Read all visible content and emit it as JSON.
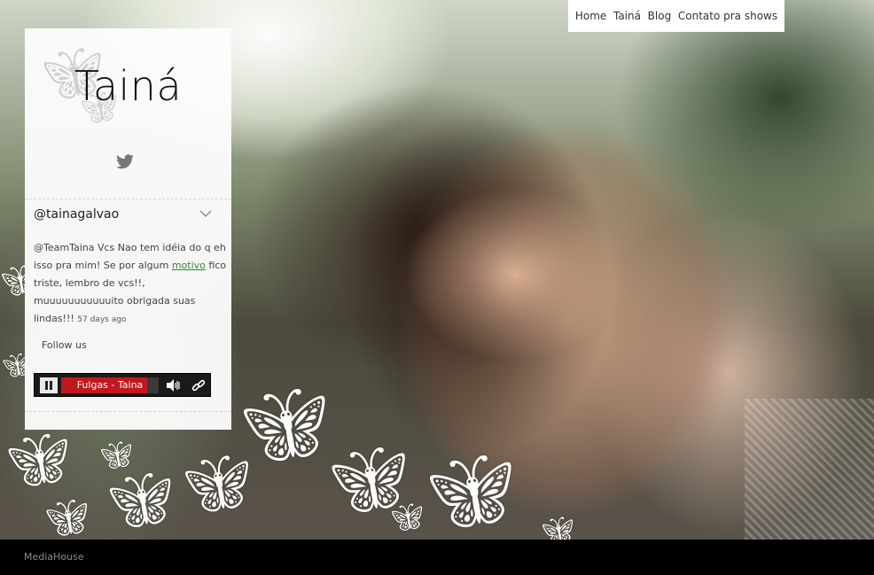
{
  "nav": {
    "items": [
      {
        "label": "Home"
      },
      {
        "label": "Tainá"
      },
      {
        "label": "Blog"
      },
      {
        "label": "Contato pra shows"
      }
    ]
  },
  "sidebar": {
    "title": "Tainá",
    "twitter": {
      "handle": "@tainagalvao",
      "tweet_before": "@TeamTaina Vcs Nao tem idéia do q eh isso pra mim! Se por algum ",
      "tweet_link": "motivo",
      "tweet_after": " fico triste, lembro de vcs!!, muuuuuuuuuuuito obrigada suas lindas!!!",
      "time_ago": "57 days ago"
    },
    "follow_label": "Follow us",
    "player": {
      "track": "Fulgas - Taina",
      "progress": 0.88,
      "accent": "#c0181e"
    }
  },
  "footer": {
    "brand": "MediaHouse"
  },
  "icons": [
    "twitter-bird-icon",
    "chevron-down-icon",
    "pause-icon",
    "volume-icon",
    "link-icon",
    "butterfly-icon"
  ]
}
